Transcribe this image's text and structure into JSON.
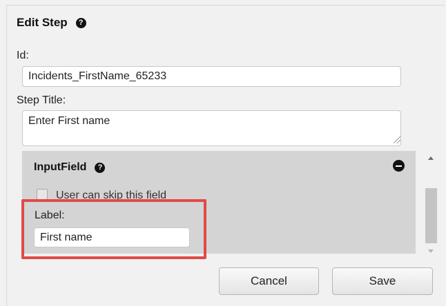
{
  "dialog": {
    "title": "Edit Step",
    "help_icon_glyph": "?"
  },
  "fields": {
    "id_label": "Id:",
    "id_value": "Incidents_FirstName_65233",
    "step_title_label": "Step Title:",
    "step_title_value": "Enter First name"
  },
  "input_field": {
    "title": "InputField",
    "help_icon_glyph": "?",
    "skip_label": "User can skip this field",
    "skip_checked": false,
    "label_caption": "Label:",
    "label_value": "First name"
  },
  "buttons": {
    "cancel": "Cancel",
    "save": "Save"
  },
  "colors": {
    "highlight": "#e04a45",
    "section_bg": "#d4d4d4",
    "page_bg": "#f1f1f1"
  }
}
